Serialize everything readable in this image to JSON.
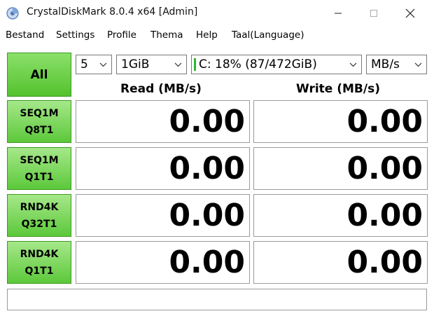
{
  "window": {
    "title": "CrystalDiskMark 8.0.4 x64 [Admin]",
    "controls": [
      "minimize-icon",
      "maximize-icon",
      "close-icon"
    ]
  },
  "menu": {
    "items": [
      "Bestand",
      "Settings",
      "Profile",
      "Thema",
      "Help",
      "Taal(Language)"
    ]
  },
  "controls": {
    "all_label": "All",
    "count": "5",
    "size": "1GiB",
    "drive": "C: 18% (87/472GiB)",
    "unit": "MB/s"
  },
  "headers": {
    "read": "Read (MB/s)",
    "write": "Write (MB/s)"
  },
  "tests": [
    {
      "line1": "SEQ1M",
      "line2": "Q8T1",
      "read": "0.00",
      "write": "0.00"
    },
    {
      "line1": "SEQ1M",
      "line2": "Q1T1",
      "read": "0.00",
      "write": "0.00"
    },
    {
      "line1": "RND4K",
      "line2": "Q32T1",
      "read": "0.00",
      "write": "0.00"
    },
    {
      "line1": "RND4K",
      "line2": "Q1T1",
      "read": "0.00",
      "write": "0.00"
    }
  ],
  "status": "",
  "colors": {
    "button_green_top": "#8be06a",
    "button_green_bottom": "#54c22e",
    "drive_indicator": "#2eb82e"
  }
}
